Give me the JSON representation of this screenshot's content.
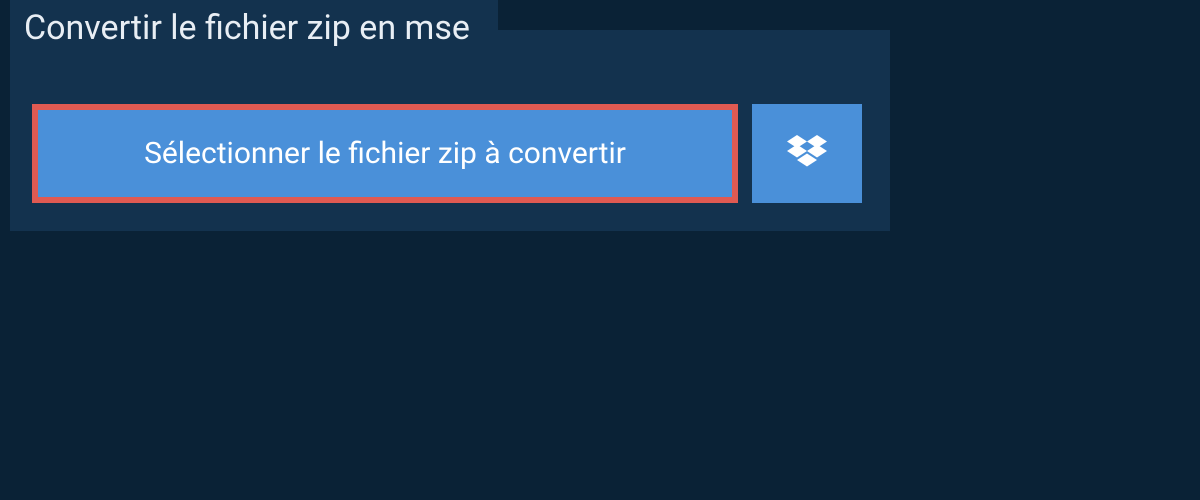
{
  "header": {
    "title": "Convertir le fichier zip en mse"
  },
  "actions": {
    "select_file_label": "Sélectionner le fichier zip à convertir",
    "dropbox_icon": "dropbox-icon"
  },
  "colors": {
    "background": "#0a2236",
    "panel": "#13324e",
    "button": "#4a90d9",
    "highlight_border": "#e05a52",
    "text_light": "#e8eef4",
    "text_white": "#ffffff"
  }
}
